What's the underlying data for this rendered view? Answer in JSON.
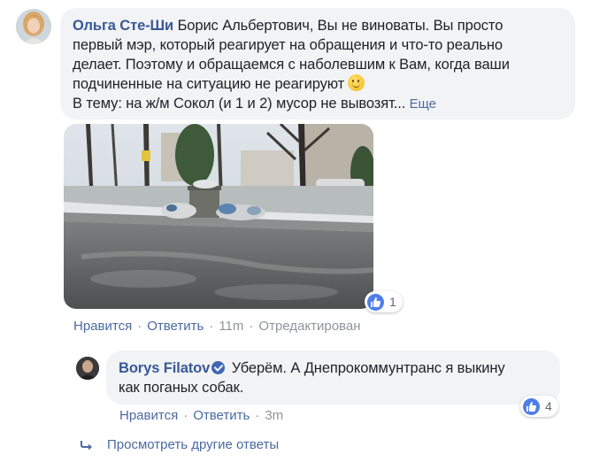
{
  "comment": {
    "author": "Ольга Сте-Ши",
    "line1": "Борис Альбертович, Вы не виноваты. Вы просто",
    "line2": "первый мэр, который реагирует на обращения и что-то реально",
    "line3": "делает. Поэтому и обращаемся с наболевшим к Вам, когда ваши",
    "line4": "подчиненные на ситуацию не реагируют",
    "line5": "В тему: на ж/м Сокол (и 1 и 2) мусор не вывозят...",
    "more_label": "Еще",
    "reaction_count": "1",
    "actions": {
      "like": "Нравится",
      "reply": "Ответить",
      "time": "11m",
      "edited": "Отредактирован"
    }
  },
  "reply": {
    "author": "Borys Filatov",
    "line1": "Уберём. А Днепрокоммунтранс я выкину",
    "line2": "как поганых собак.",
    "reaction_count": "4",
    "actions": {
      "like": "Нравится",
      "reply": "Ответить",
      "time": "3m"
    }
  },
  "view_more_replies": "Просмотреть другие ответы",
  "colors": {
    "link": "#385898",
    "bubble": "#f2f3f5",
    "like_blue": "#4f7ee8"
  }
}
